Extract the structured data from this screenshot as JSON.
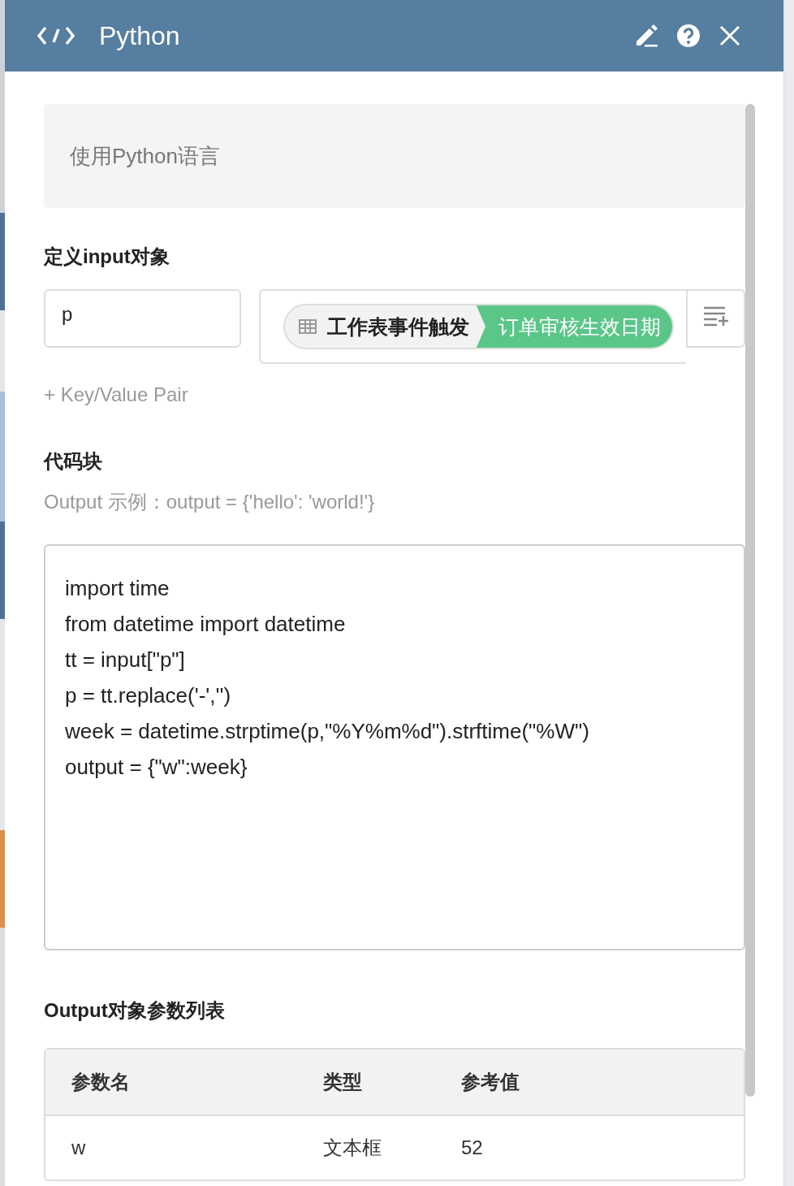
{
  "header": {
    "title": "Python"
  },
  "description": "使用Python语言",
  "input_section": {
    "title": "定义input对象",
    "pairs": [
      {
        "key": "p",
        "source": "工作表事件触发",
        "field": "订单审核生效日期"
      }
    ],
    "add_link": "+ Key/Value Pair"
  },
  "code_section": {
    "title": "代码块",
    "hint": "Output 示例：output = {'hello': 'world!'}",
    "lines": [
      "import time",
      "from datetime import datetime",
      "tt = input[\"p\"]",
      "p = tt.replace('-','')",
      "week = datetime.strptime(p,\"%Y%m%d\").strftime(\"%W\")",
      "output = {\"w\":week}"
    ]
  },
  "output_section": {
    "title": "Output对象参数列表",
    "table": {
      "columns": [
        "参数名",
        "类型",
        "参考值"
      ],
      "rows": [
        [
          "w",
          "文本框",
          "52"
        ]
      ]
    }
  }
}
